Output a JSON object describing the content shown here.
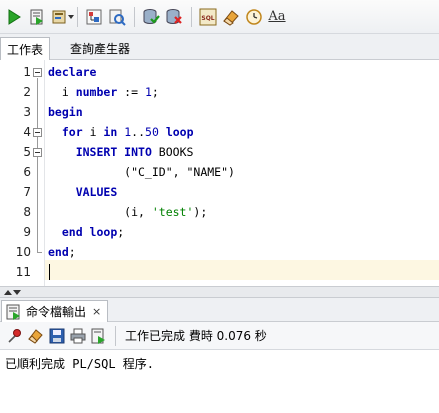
{
  "toolbar": {
    "buttons": [
      {
        "name": "run-statement",
        "icon": "play-icon"
      },
      {
        "name": "run-script",
        "icon": "script-icon"
      },
      {
        "name": "autotrace",
        "icon": "autotrace-icon"
      },
      {
        "name": "explain-plan",
        "icon": "explain-icon"
      },
      {
        "name": "sql-tuning",
        "icon": "tuning-icon"
      },
      {
        "name": "commit",
        "icon": "commit-icon"
      },
      {
        "name": "rollback",
        "icon": "rollback-icon"
      },
      {
        "name": "sql-format",
        "icon": "sql-icon"
      },
      {
        "name": "clear",
        "icon": "eraser-icon"
      },
      {
        "name": "history",
        "icon": "clock-icon"
      },
      {
        "name": "case-toggle",
        "icon": "aa-icon",
        "label": "Aa"
      }
    ]
  },
  "tabs": [
    {
      "label": "工作表",
      "active": true
    },
    {
      "label": "查詢產生器",
      "active": false
    }
  ],
  "editor": {
    "line_numbers": [
      "1",
      "2",
      "3",
      "4",
      "5",
      "6",
      "7",
      "8",
      "9",
      "10",
      "11"
    ],
    "current_line": "11"
  },
  "output": {
    "tab_label": "命令檔輸出",
    "close_label": "×",
    "status": "工作已完成 費時 0.076 秒",
    "message": "已順利完成 PL/SQL 程序."
  },
  "colors": {
    "keyword": "#0000b0",
    "string": "#008000",
    "current_line": "#fdf7e2"
  }
}
